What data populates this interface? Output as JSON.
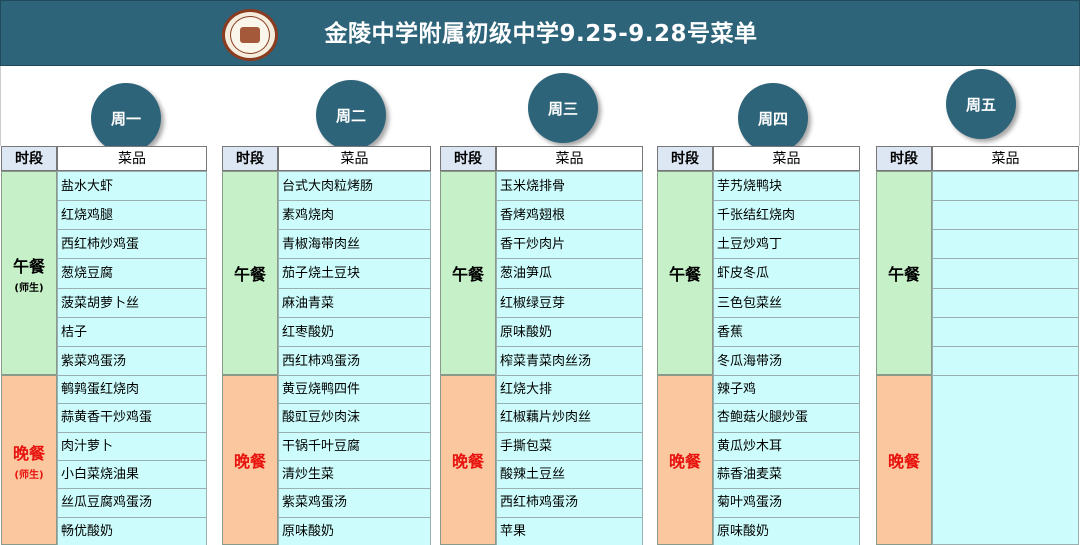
{
  "header": {
    "title": "金陵中学附属初级中学9.25-9.28号菜单",
    "bg_color": "#2e6479",
    "logo_icon": "school-seal-icon"
  },
  "table_header": {
    "time": "时段",
    "dish": "菜品"
  },
  "colors": {
    "lunch_bg": "#c6f0c8",
    "dinner_bg": "#fbc79f",
    "dinner_text": "#e8130e",
    "dish_bg": "#ccfdfc",
    "day_circle": "#2e6479"
  },
  "days": [
    {
      "name": "周一",
      "lunch": {
        "label": "午餐",
        "sub": "(师生)",
        "dishes": [
          "盐水大虾",
          "红烧鸡腿",
          "西红柿炒鸡蛋",
          "葱烧豆腐",
          "菠菜胡萝卜丝",
          "桔子",
          "紫菜鸡蛋汤"
        ]
      },
      "dinner": {
        "label": "晚餐",
        "sub": "(师生)",
        "dishes": [
          "鹌鹑蛋红烧肉",
          "蒜黄香干炒鸡蛋",
          "肉汁萝卜",
          "小白菜烧油果",
          "丝瓜豆腐鸡蛋汤",
          "畅优酸奶"
        ]
      }
    },
    {
      "name": "周二",
      "lunch": {
        "label": "午餐",
        "sub": "",
        "dishes": [
          "台式大肉粒烤肠",
          "素鸡烧肉",
          "青椒海带肉丝",
          "茄子烧土豆块",
          "麻油青菜",
          "红枣酸奶",
          "西红柿鸡蛋汤"
        ]
      },
      "dinner": {
        "label": "晚餐",
        "sub": "",
        "dishes": [
          "黄豆烧鸭四件",
          "酸豇豆炒肉沫",
          "干锅千叶豆腐",
          "清炒生菜",
          "紫菜鸡蛋汤",
          "原味酸奶"
        ]
      }
    },
    {
      "name": "周三",
      "lunch": {
        "label": "午餐",
        "sub": "",
        "dishes": [
          "玉米烧排骨",
          "香烤鸡翅根",
          "香干炒肉片",
          "葱油笋瓜",
          "红椒绿豆芽",
          "原味酸奶",
          "榨菜青菜肉丝汤"
        ]
      },
      "dinner": {
        "label": "晚餐",
        "sub": "",
        "dishes": [
          "红烧大排",
          "红椒藕片炒肉丝",
          "手撕包菜",
          "酸辣土豆丝",
          "西红柿鸡蛋汤",
          "苹果"
        ]
      }
    },
    {
      "name": "周四",
      "lunch": {
        "label": "午餐",
        "sub": "",
        "dishes": [
          "芋艿烧鸭块",
          "千张结红烧肉",
          "土豆炒鸡丁",
          "虾皮冬瓜",
          "三色包菜丝",
          "香蕉",
          "冬瓜海带汤"
        ]
      },
      "dinner": {
        "label": "晚餐",
        "sub": "",
        "dishes": [
          "辣子鸡",
          "杏鲍菇火腿炒蛋",
          "黄瓜炒木耳",
          "蒜香油麦菜",
          "菊叶鸡蛋汤",
          "原味酸奶"
        ]
      }
    },
    {
      "name": "周五",
      "lunch": {
        "label": "午餐",
        "sub": "",
        "dishes": [
          "",
          "",
          "",
          "",
          "",
          "",
          ""
        ]
      },
      "dinner": {
        "label": "晚餐",
        "sub": "",
        "dishes": []
      }
    }
  ]
}
